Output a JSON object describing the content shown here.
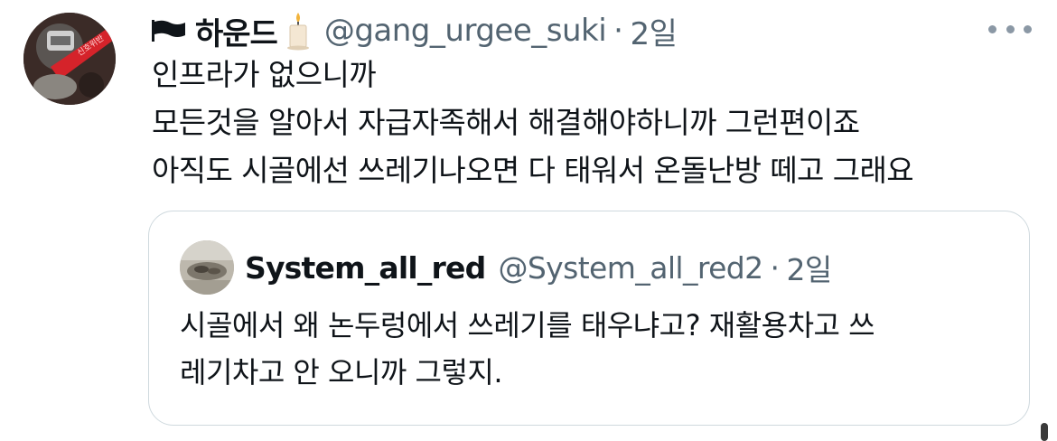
{
  "tweet": {
    "display_name": "하운드",
    "handle": "@gang_urgee_suki",
    "separator": "·",
    "time": "2일",
    "lines": [
      "인프라가 없으니까",
      "모든것을 알아서 자급자족해서 해결해야하니까 그런편이죠",
      "아직도 시골에선 쓰레기나오면 다 태워서 온돌난방 떼고 그래요"
    ]
  },
  "quote": {
    "display_name": "System_all_red",
    "handle": "@System_all_red2",
    "separator": "·",
    "time": "2일",
    "lines": [
      "시골에서 왜 논두렁에서 쓰레기를 태우냐고? 재활용차고 쓰",
      "레기차고 안 오니까 그렇지."
    ]
  },
  "icons": {
    "flag": "black-flag-icon",
    "candle": "candle-icon",
    "more": "more-options-icon"
  },
  "colors": {
    "text": "#0f1419",
    "secondary": "#536471",
    "border": "#cfd9de"
  }
}
